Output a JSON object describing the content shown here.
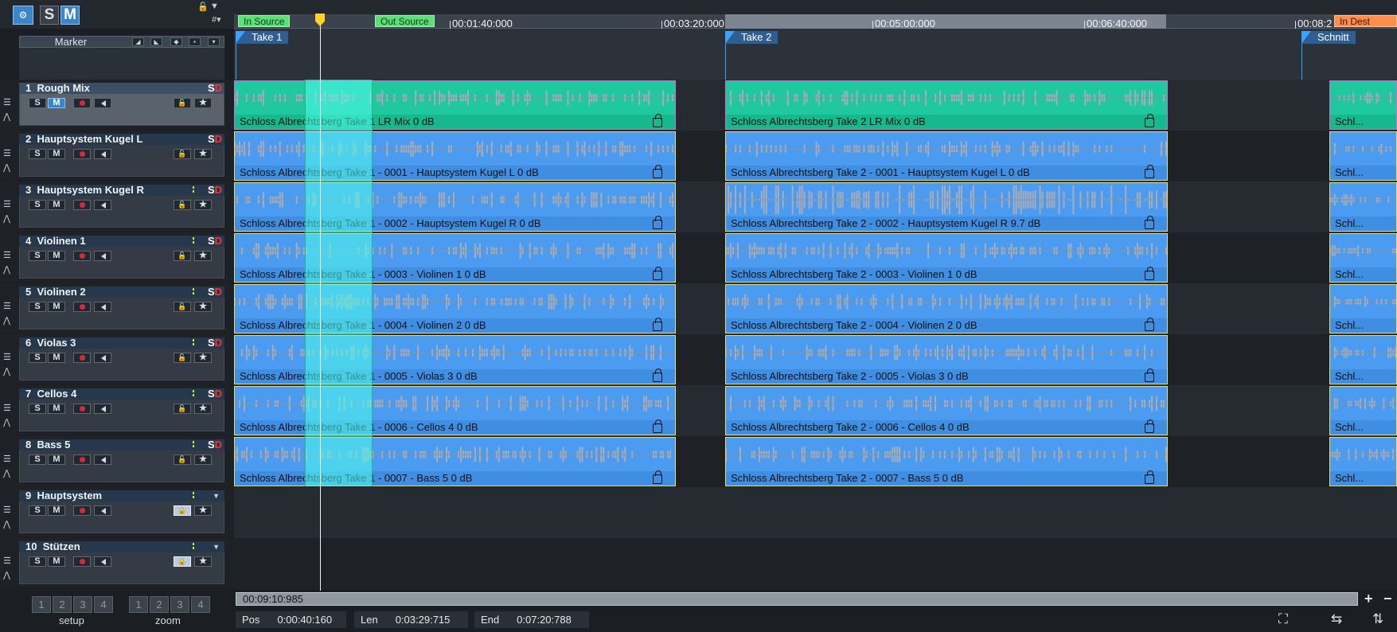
{
  "toolbar": {
    "solo_label": "S",
    "mute_label": "M"
  },
  "marker_panel": {
    "label": "Marker"
  },
  "timeline": {
    "in_source": "In Source",
    "out_source": "Out Source",
    "in_dest": "In Dest",
    "ticks": [
      "00:01:40:000",
      "00:03:20:000",
      "00:05:00:000",
      "00:06:40:000",
      "00:08:2"
    ]
  },
  "markers": [
    "Take 1",
    "Take 2",
    "Schnitt"
  ],
  "tracks": [
    {
      "num": "1",
      "name": "Rough Mix"
    },
    {
      "num": "2",
      "name": "Hauptsystem Kugel L"
    },
    {
      "num": "3",
      "name": "Hauptsystem Kugel R"
    },
    {
      "num": "4",
      "name": "Violinen 1"
    },
    {
      "num": "5",
      "name": "Violinen 2"
    },
    {
      "num": "6",
      "name": "Violas 3"
    },
    {
      "num": "7",
      "name": "Cellos 4"
    },
    {
      "num": "8",
      "name": "Bass 5"
    },
    {
      "num": "9",
      "name": "Hauptsystem"
    },
    {
      "num": "10",
      "name": "Stützen"
    }
  ],
  "track_buttons": {
    "solo": "S",
    "mute": "M",
    "star": "★",
    "sd_s": "S",
    "sd_d": "D"
  },
  "clips_take1": [
    "Schloss Albrechtsberg Take 1 LR Mix    0 dB",
    "Schloss Albrechtsberg Take 1 - 0001 - Hauptsystem Kugel L    0 dB",
    "Schloss Albrechtsberg Take 1 - 0002 - Hauptsystem Kugel R    0 dB",
    "Schloss Albrechtsberg Take 1 - 0003 - Violinen 1    0 dB",
    "Schloss Albrechtsberg Take 1 - 0004 - Violinen 2    0 dB",
    "Schloss Albrechtsberg Take 1 - 0005 - Violas 3    0 dB",
    "Schloss Albrechtsberg Take 1 - 0006 - Cellos 4    0 dB",
    "Schloss Albrechtsberg Take 1 - 0007 - Bass 5    0 dB"
  ],
  "clips_take2": [
    "Schloss Albrechtsberg Take 2 LR Mix    0 dB",
    "Schloss Albrechtsberg Take 2 - 0001 - Hauptsystem Kugel L    0 dB",
    "Schloss Albrechtsberg Take 2 - 0002 - Hauptsystem Kugel R    9.7 dB",
    "Schloss Albrechtsberg Take 2 - 0003 - Violinen 1    0 dB",
    "Schloss Albrechtsberg Take 2 - 0004 - Violinen 2    0 dB",
    "Schloss Albrechtsberg Take 2 - 0005 - Violas 3    0 dB",
    "Schloss Albrechtsberg Take 2 - 0006 - Cellos 4    0 dB",
    "Schloss Albrechtsberg Take 2 - 0007 - Bass 5    0 dB"
  ],
  "clips_take3": [
    "Schl...",
    "Schl...",
    "Schl...",
    "Schl...",
    "Schl...",
    "Schl...",
    "Schl...",
    "Schl..."
  ],
  "scroll_time": "00:09:10:985",
  "status": {
    "pos_label": "Pos",
    "pos_value": "0:00:40:160",
    "len_label": "Len",
    "len_value": "0:03:29:715",
    "end_label": "End",
    "end_value": "0:07:20:788"
  },
  "bottom_left": {
    "numbers": [
      "1",
      "2",
      "3",
      "4"
    ],
    "setup_label": "setup",
    "zoom_label": "zoom"
  },
  "colors": {
    "clip_blue": "#4b9cf1",
    "clip_green": "#20c8a0",
    "accent": "#3a86c8",
    "in_out": "#5ddf78",
    "in_dest": "#ff8d4b"
  }
}
